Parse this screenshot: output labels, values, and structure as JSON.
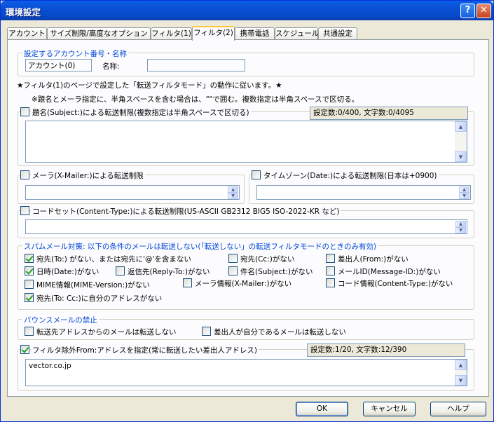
{
  "window": {
    "title": "環境設定",
    "help_symbol": "?",
    "close_symbol": "✕"
  },
  "tabs": [
    "アカウント",
    "サイズ制限/高度なオプション",
    "フィルタ(1)",
    "フィルタ(2)",
    "携帯電話",
    "スケジュール",
    "共通設定"
  ],
  "account": {
    "group_label": "設定するアカウント番号・名称",
    "number": "アカウント(0)",
    "name_label": "名称:",
    "name_value": ""
  },
  "notes": {
    "line1": "★フィルタ(1)のページで設定した「転送フィルタモード」の動作に従います。★",
    "line2": "※題名とメーラ指定に、半角スペースを含む場合は、\"\"で囲む。複数指定は半角スペースで区切る。"
  },
  "subject": {
    "label": "題名(Subject:)による転送制限(複数指定は半角スペースで区切る)",
    "checked": false,
    "count": "設定数:0/400, 文字数:0/4095",
    "value": ""
  },
  "mailer": {
    "label": "メーラ(X-Mailer:)による転送制限",
    "checked": false,
    "value": ""
  },
  "timezone": {
    "label": "タイムゾーン(Date:)による転送制限(日本は+0900)",
    "checked": false,
    "value": ""
  },
  "codeset": {
    "label": "コードセット(Content-Type:)による転送制限(US-ASCII  GB2312  BIG5  ISO-2022-KR など)",
    "checked": false,
    "value": ""
  },
  "spam": {
    "group_label": "スパムメール対策: 以下の条件のメールは転送しない(「転送しない」の転送フィルタモードのときのみ有効)",
    "items": [
      {
        "label": "宛先(To:) がない、または宛先に'@'を含まない",
        "checked": true
      },
      {
        "label": "宛先(Cc:)がない",
        "checked": false
      },
      {
        "label": "差出人(From:)がない",
        "checked": false
      },
      {
        "label": "日時(Date:)がない",
        "checked": true
      },
      {
        "label": "返信先(Reply-To:)がない",
        "checked": false
      },
      {
        "label": "件名(Subject:)がない",
        "checked": false
      },
      {
        "label": "メールID(Message-ID:)がない",
        "checked": false
      },
      {
        "label": "MIME情報(MIME-Version:)がない",
        "checked": false
      },
      {
        "label": "メーラ情報(X-Mailer:)がない",
        "checked": false
      },
      {
        "label": "コード情報(Content-Type:)がない",
        "checked": false
      },
      {
        "label": "宛先(To: Cc:)に自分のアドレスがない",
        "checked": true
      }
    ]
  },
  "bounce": {
    "group_label": "バウンスメールの禁止",
    "items": [
      {
        "label": "転送先アドレスからのメールは転送しない",
        "checked": false
      },
      {
        "label": "差出人が自分であるメールは転送しない",
        "checked": false
      }
    ]
  },
  "exclude": {
    "label": "フィルタ除外From:アドレスを指定(常に転送したい差出人アドレス)",
    "checked": true,
    "count": "設定数:1/20, 文字数:12/390",
    "value": "vector.co.jp"
  },
  "buttons": {
    "ok": "OK",
    "cancel": "キャンセル",
    "help": "ヘルプ"
  },
  "colors": {
    "accent": "#0046D5",
    "titlebar": "#0A5FE8"
  }
}
